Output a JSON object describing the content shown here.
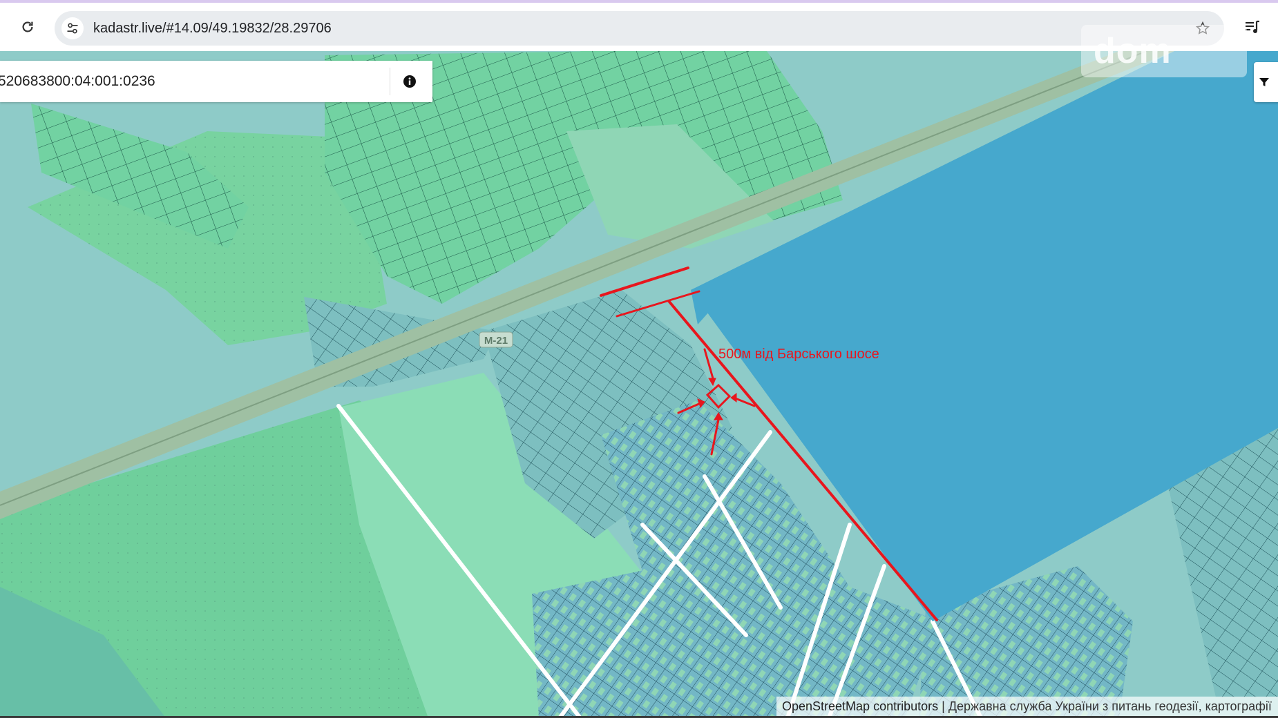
{
  "browser": {
    "url": "kadastr.live/#14.09/49.19832/28.29706",
    "reload_icon": "reload-icon",
    "site_info_icon": "tune-icon",
    "bookmark_icon": "star-icon",
    "media_icon": "playlist-icon"
  },
  "map": {
    "search_value": "520683800:04:001:0236",
    "info_icon": "info-icon",
    "filter_icon": "filter-icon",
    "road_label": "M-21",
    "annotation": "500м від Барського шосе",
    "watermark": "dom",
    "attribution_link": "OpenStreetMap contributors",
    "attribution_text": "| Державна служба України з питань геодезії, картографії",
    "colors": {
      "water": "#46a8cd",
      "parcel_green": "#72d2a2",
      "field_green": "#8ad9b3",
      "teal_land": "#8ecbc8",
      "annotation_red": "#e8161d"
    }
  }
}
